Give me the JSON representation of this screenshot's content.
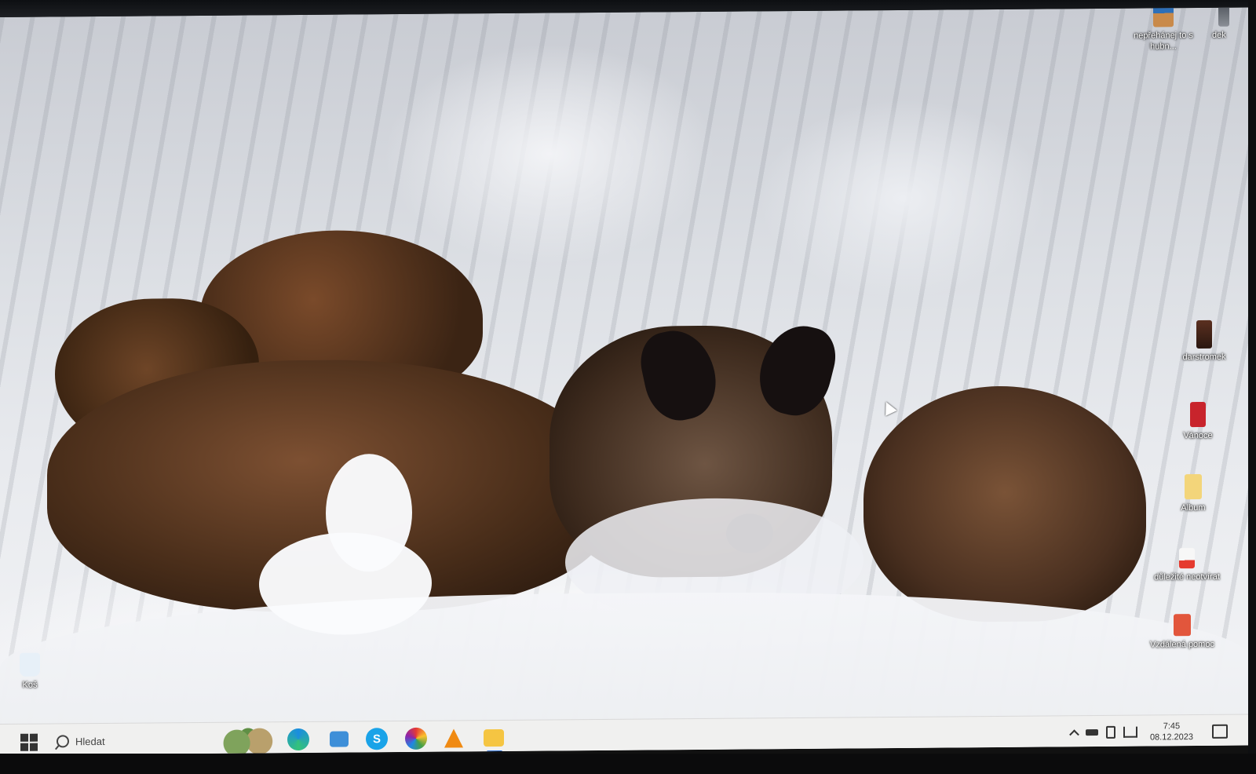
{
  "desktop": {
    "icons_right_top": [
      {
        "label": "nepřehánej to s hubn...",
        "icon": "image-file-icon"
      },
      {
        "label": "dek",
        "icon": "image-file-icon"
      }
    ],
    "icons_right": [
      {
        "label": "darstromek",
        "icon": "book-file-icon"
      },
      {
        "label": "Vánoce",
        "icon": "red-file-icon"
      },
      {
        "label": "Album",
        "icon": "folder-icon"
      },
      {
        "label": "důležité neotvírat",
        "icon": "pdf-file-icon"
      },
      {
        "label": "Vzdálená pomoc",
        "icon": "remote-help-icon"
      }
    ],
    "recycle_bin": {
      "label": "Koš",
      "icon": "recycle-bin-icon"
    }
  },
  "taskbar": {
    "search_placeholder": "Hledat",
    "apps": [
      {
        "name": "Microsoft Edge",
        "icon": "edge-icon",
        "active": true
      },
      {
        "name": "Files",
        "icon": "files-icon",
        "active": false
      },
      {
        "name": "Skype",
        "icon": "skype-icon",
        "glyph": "S",
        "active": false
      },
      {
        "name": "Picasa",
        "icon": "picasa-icon",
        "active": true
      },
      {
        "name": "VLC",
        "icon": "vlc-icon",
        "active": false
      },
      {
        "name": "File Explorer",
        "icon": "file-explorer-icon",
        "active": true
      }
    ],
    "clock": {
      "time": "7:45",
      "date": "08.12.2023"
    }
  }
}
